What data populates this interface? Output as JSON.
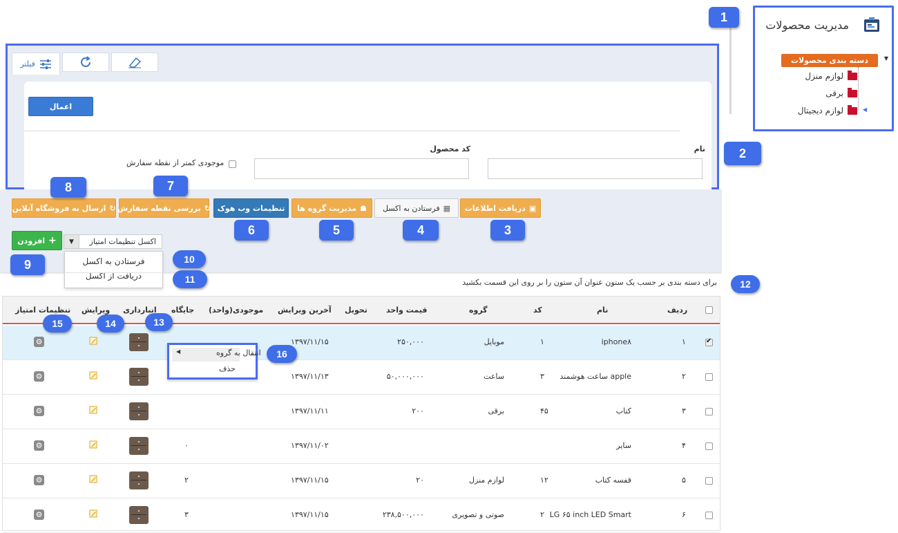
{
  "sidebar": {
    "title": "مدیریت محصولات",
    "category_label": "دسته بندی محصولات",
    "items": [
      {
        "label": "لوازم منزل"
      },
      {
        "label": "برقی"
      },
      {
        "label": "لوازم دیجیتال"
      }
    ]
  },
  "filter": {
    "tab_filter_label": "فیلتر",
    "apply_label": "اعمال",
    "name_label": "نام",
    "code_label": "کد محصول",
    "stock_label": "موجودی کمتر از نقطه سفارش"
  },
  "toolbar": {
    "receive_info": "دریافت اطلاعات",
    "send_excel": "فرستادن به اکسل",
    "group_manage": "مدیریت گروه ها",
    "webhook": "تنظیمات وب هوک",
    "order_point": "بررسی نقطه سفارش",
    "send_shop": "ارسال به فروشگاه آنلاین",
    "add": "افزودن",
    "score_excel": "اکسل تنظیمات امتیاز"
  },
  "excel_menu": {
    "send": "فرستادن به اکسل",
    "receive": "دریافت از اکسل"
  },
  "hint": "برای دسته بندی بر حسب یک ستون عنوان آن ستون را بر روی این قسمت بکشید",
  "table": {
    "headers": {
      "row": "ردیف",
      "name": "نام",
      "code": "کد",
      "group": "گروه",
      "unit_price": "قیمت واحد",
      "delivery": "تحویل",
      "last_edit": "آخرین ویرایش",
      "stock": "موجودی(واحد)",
      "location": "جایگاه",
      "warehouse": "انبارداری",
      "edit": "ویرایش",
      "score_settings": "تنظیمات امتیاز"
    },
    "rows": [
      {
        "idx": "۱",
        "name": "iphone۸",
        "code": "۱",
        "group": "موبایل",
        "price": "۲۵۰,۰۰۰",
        "date": "۱۳۹۷/۱۱/۱۵",
        "stock": "",
        "location": "",
        "checked": true
      },
      {
        "idx": "۲",
        "name": "ساعت هوشمند apple",
        "code": "۳",
        "group": "ساعت",
        "price": "۵۰,۰۰۰,۰۰۰",
        "date": "۱۳۹۷/۱۱/۱۳",
        "stock": "",
        "location": "",
        "checked": false
      },
      {
        "idx": "۳",
        "name": "کتاب",
        "code": "۴۵",
        "group": "برقی",
        "price": "۲۰۰",
        "date": "۱۳۹۷/۱۱/۱۱",
        "stock": "",
        "location": "",
        "checked": false
      },
      {
        "idx": "۴",
        "name": "سایر",
        "code": "",
        "group": "",
        "price": "",
        "date": "۱۳۹۷/۱۱/۰۲",
        "stock": "",
        "location": "۰",
        "checked": false
      },
      {
        "idx": "۵",
        "name": "قفسه کتاب",
        "code": "۱۲",
        "group": "لوازم منزل",
        "price": "۲۰",
        "date": "۱۳۹۷/۱۱/۱۵",
        "stock": "",
        "location": "۲",
        "checked": false
      },
      {
        "idx": "۶",
        "name": "LG ۶۵ inch LED Smart",
        "code": "۲",
        "group": "صوتی و تصویری",
        "price": "۲۳۸,۵۰۰,۰۰۰",
        "date": "۱۳۹۷/۱۱/۱۵",
        "stock": "",
        "location": "۳",
        "checked": false
      }
    ]
  },
  "context_menu": {
    "move_group": "انتقال به گروه",
    "delete": "حذف"
  },
  "badges": [
    "1",
    "2",
    "3",
    "4",
    "5",
    "6",
    "7",
    "8",
    "9",
    "10",
    "11",
    "12",
    "13",
    "14",
    "15",
    "16"
  ],
  "colors": {
    "accent": "#4a6cf0",
    "orange": "#f0ad4e",
    "blue": "#337ab7",
    "green": "#3cb54a",
    "category": "#e46b1f"
  }
}
